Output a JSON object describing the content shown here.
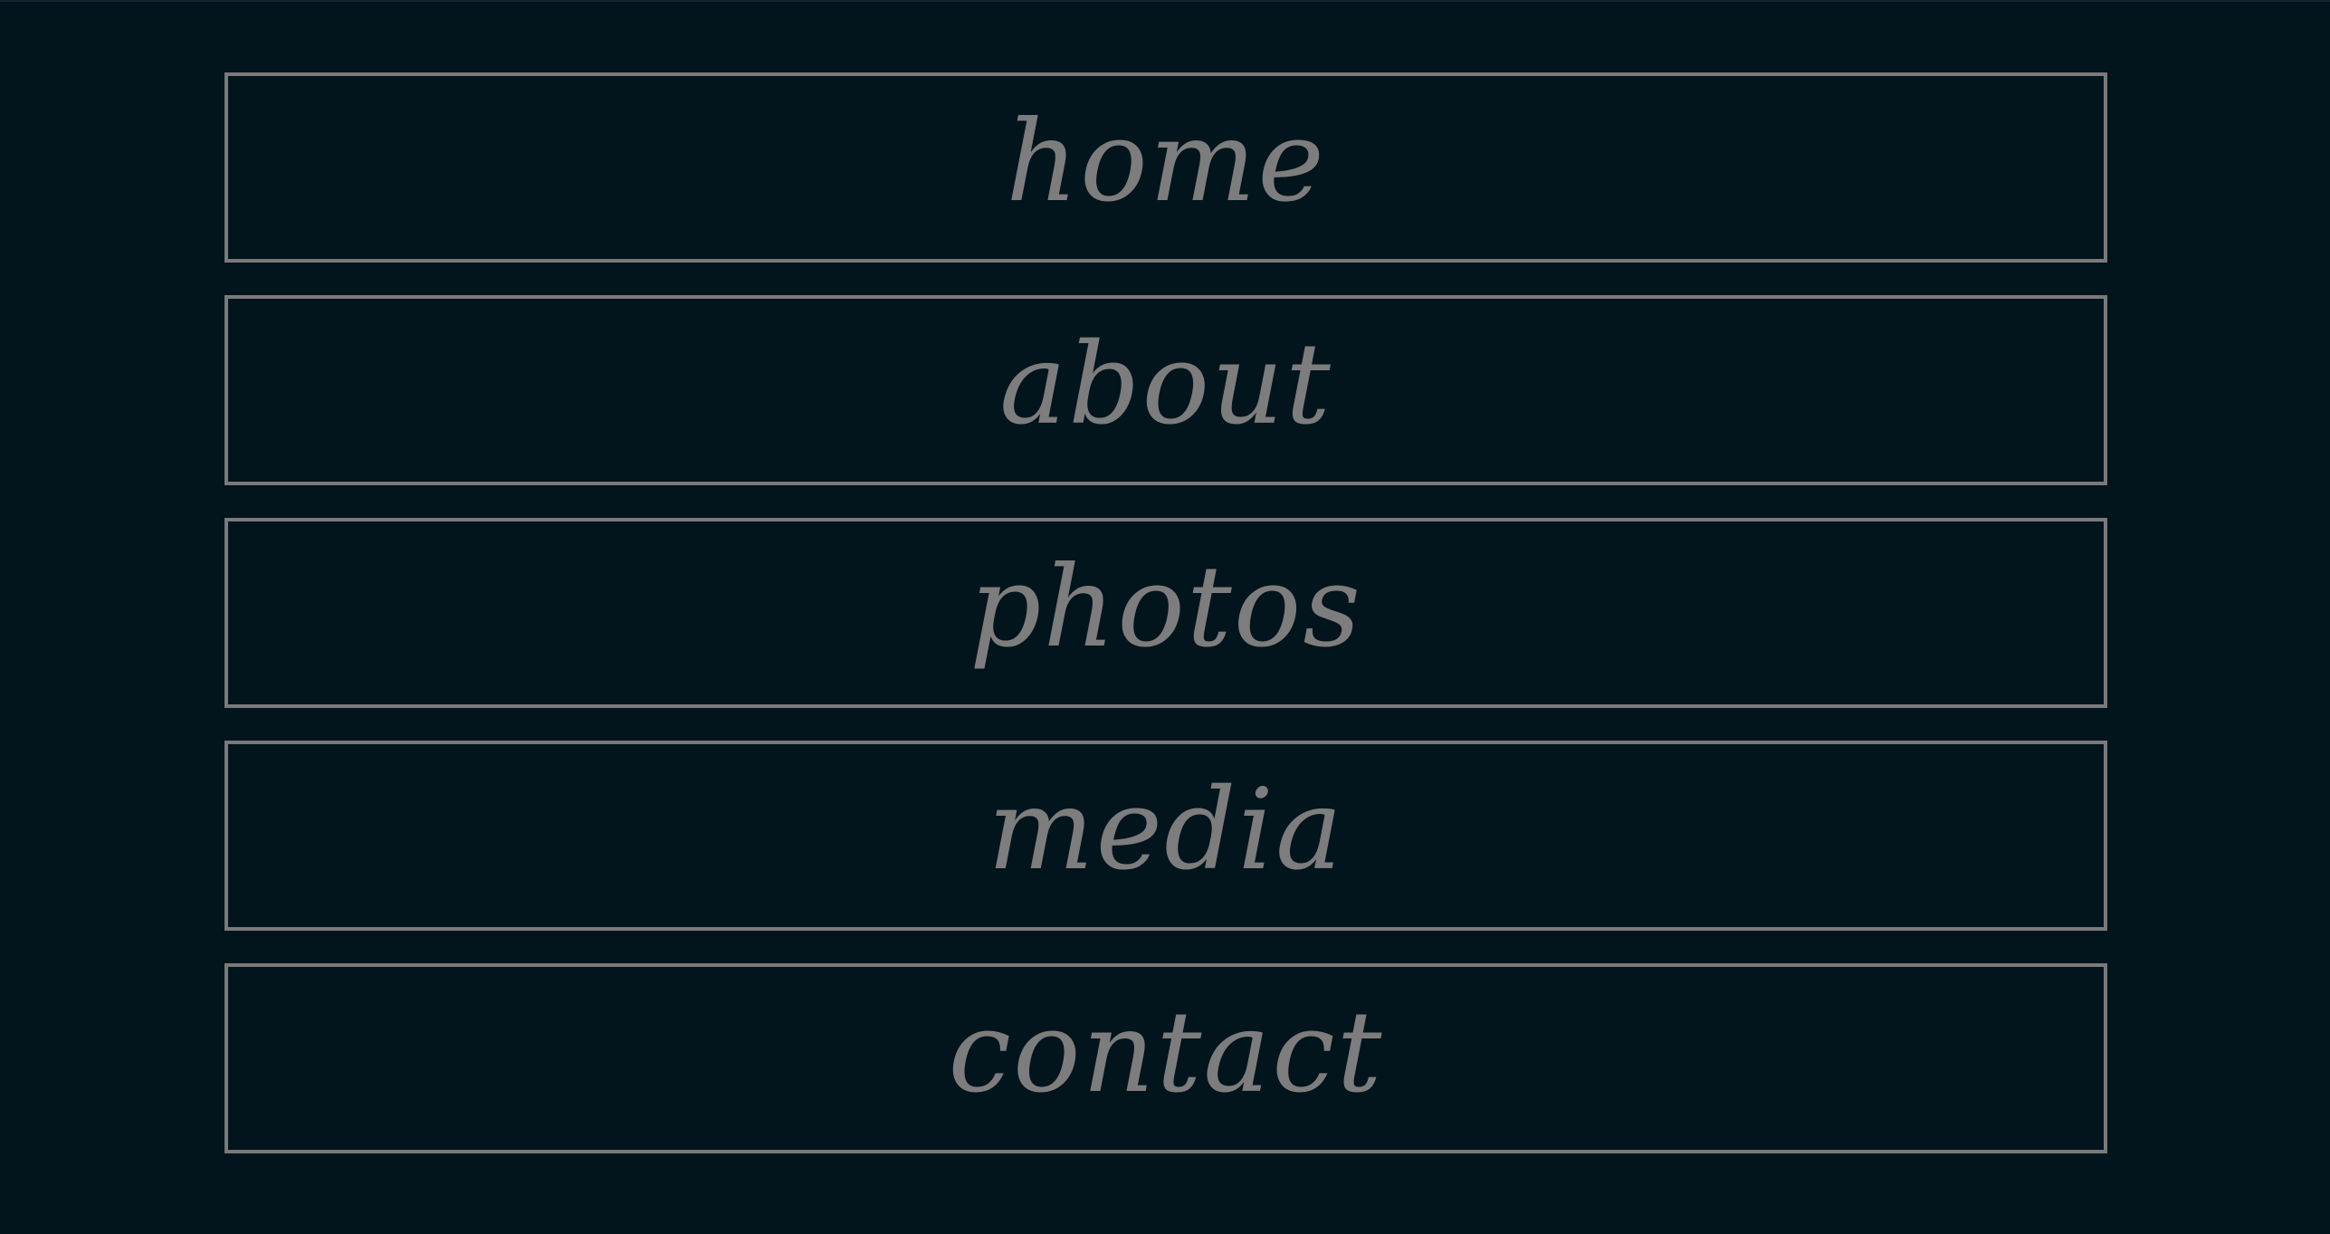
{
  "nav": {
    "items": [
      {
        "label": "home"
      },
      {
        "label": "about"
      },
      {
        "label": "photos"
      },
      {
        "label": "media"
      },
      {
        "label": "contact"
      }
    ]
  },
  "colors": {
    "background": "#02141c",
    "border": "#7a7a7a",
    "text": "#7d7d7d"
  }
}
